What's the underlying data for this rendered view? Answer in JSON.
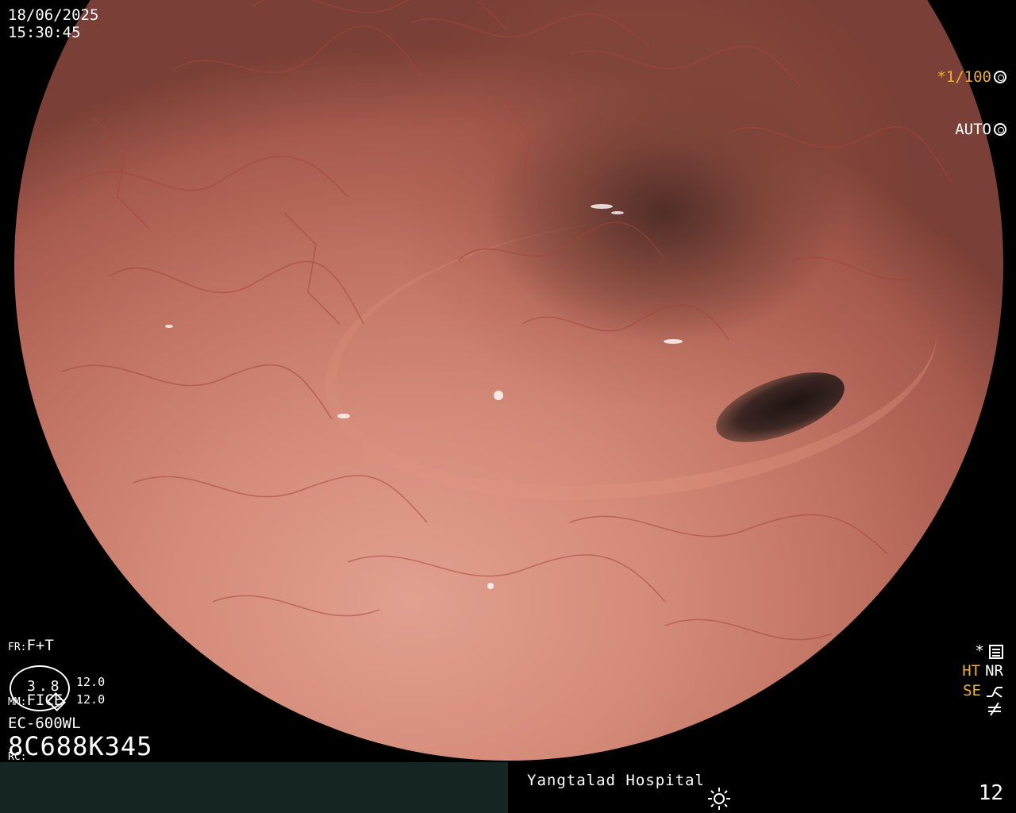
{
  "overlay": {
    "date": "18/06/2025",
    "time": "15:30:45",
    "shutter": "*1/100",
    "shutter_icon": "aperture-icon",
    "exposure_mode": "AUTO",
    "exposure_icon": "iris-icon",
    "fr_label": "FR:",
    "fr_value": "F+T",
    "mm_label": "MM:",
    "mm_value": "FICE",
    "rc_label": "RC:",
    "zoom_value": "3.8",
    "zoom_range_top": "12.0",
    "zoom_range_bottom": "12.0",
    "scope_model": "EC-600WL",
    "serial_number": "8C688K345",
    "menu_star": "*",
    "menu_icon": "menu-icon",
    "ht_label": "HT",
    "nr_label": "NR",
    "se_label": "SE",
    "se_icon": "curve-icon",
    "misc_icon": "not-equal-icon"
  },
  "footer": {
    "hospital": "Yangtalad Hospital",
    "light_icon": "light-icon",
    "image_count": "12"
  },
  "colors": {
    "highlight": "#f0b030",
    "bar_left": "#142524",
    "mucosa": "#c27464"
  }
}
